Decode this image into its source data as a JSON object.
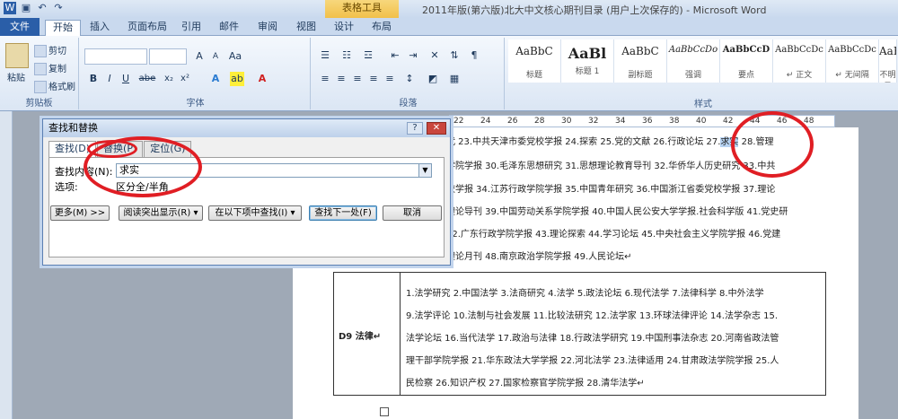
{
  "window": {
    "title": "2011年版(第六版)北大中文核心期刊目录 (用户上次保存的) - Microsoft Word",
    "context_tab_header": "表格工具"
  },
  "ribbon_tabs": [
    "文件",
    "开始",
    "插入",
    "页面布局",
    "引用",
    "邮件",
    "审阅",
    "视图",
    "设计",
    "布局"
  ],
  "clipboard": {
    "paste": "粘贴",
    "cut": "剪切",
    "copy": "复制",
    "format_painter": "格式刷",
    "label": "剪贴板"
  },
  "font_group": {
    "label": "字体",
    "bold": "B",
    "italic": "I",
    "underline": "U",
    "strike": "abe",
    "sub": "x₂",
    "sup": "x²",
    "clear": "Aa",
    "grow": "A",
    "shrink": "A"
  },
  "paragraph_group": {
    "label": "段落"
  },
  "styles_group": {
    "label": "样式",
    "styles": [
      {
        "sample": "AaBbC",
        "name": "标题"
      },
      {
        "sample": "AaBl",
        "name": "标题 1"
      },
      {
        "sample": "AaBbC",
        "name": "副标题"
      },
      {
        "sample": "AaBbCcDo",
        "name": "强调"
      },
      {
        "sample": "AaBbCcD",
        "name": "要点"
      },
      {
        "sample": "AaBbCcDc",
        "name": "↵ 正文"
      },
      {
        "sample": "AaBbCcDc",
        "name": "↵ 无间隔"
      },
      {
        "sample": "AaBbC",
        "name": "不明显"
      }
    ]
  },
  "ruler_marks": [
    "22",
    "24",
    "26",
    "28",
    "30",
    "32",
    "34",
    "36",
    "38",
    "40",
    "42",
    "44",
    "46",
    "48"
  ],
  "find_dialog": {
    "title": "查找和替换",
    "help": "?",
    "close": "✕",
    "tabs": [
      "查找(D)",
      "替换(P)",
      "定位(G)"
    ],
    "find_label": "查找内容(N):",
    "find_value": "求实",
    "options_label": "选项:",
    "options_value": "区分全/半角",
    "buttons": {
      "more": "更多(M) >>",
      "reading_highlight": "阅读突出显示(R) ▾",
      "find_in": "在以下项中查找(I) ▾",
      "find_next": "查找下一处(F)",
      "cancel": "取消"
    }
  },
  "document": {
    "upper_lines": [
      "代  23.中共天津市委党校学报  24.探索  25.党的文献  26.行政论坛  27.",
      "学院学报  30.毛泽东思想研究  31.思想理论教育导刊  32.华侨华人历史研究  33.中共",
      "校学报  34.江苏行政学院学报  35.中国青年研究  36.中国浙江省委党校学报  37.理论",
      "理论导刊  39.中国劳动关系学院学报  40.中国人民公安大学学报.社会科学版  41.党史研",
      "42.广东行政学院学报  43.理论探索  44.学习论坛  45.中央社会主义学院学报  46.党建",
      "理论月刊  48.南京政治学院学报  49.人民论坛↵"
    ],
    "highlight_word": "求实",
    "after_highlight": "  28.管理",
    "category": "D9 法律↵",
    "table_lines": [
      "1.法学研究  2.中国法学  3.法商研究  4.法学  5.政法论坛  6.现代法学  7.法律科学  8.中外法学",
      "9.法学评论  10.法制与社会发展  11.比较法研究  12.法学家  13.环球法律评论  14.法学杂志  15.",
      "法学论坛  16.当代法学  17.政治与法律  18.行政法学研究  19.中国刑事法杂志  20.河南省政法管",
      "理干部学院学报  21.华东政法大学学报  22.河北法学  23.法律适用  24.甘肃政法学院学报  25.人",
      "民检察  26.知识产权  27.国家检察官学院学报  28.清华法学↵"
    ]
  },
  "colors": {
    "annotation": "#e01e24",
    "file_tab": "#2a5ea8",
    "highlight": "#b7d3f2"
  }
}
